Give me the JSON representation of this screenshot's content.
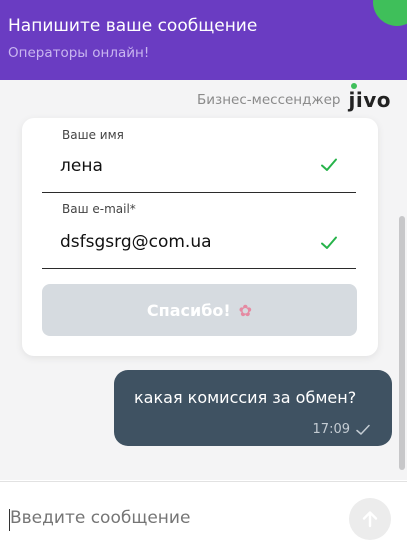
{
  "header": {
    "title": "Напишите ваше сообщение",
    "subtitle": "Операторы онлайн!"
  },
  "brand": {
    "text": "Бизнес-мессенджер",
    "logo": "jivo"
  },
  "form": {
    "name_label": "Ваше имя",
    "name_value": "лена",
    "email_label": "Ваш e-mail*",
    "email_value": "dsfsgsrg@com.ua",
    "submit_label": "Спасибо!",
    "submit_icon": "party-popper-icon"
  },
  "message": {
    "text": "какая комиссия за обмен?",
    "time": "17:09"
  },
  "composer": {
    "placeholder": "Введите сообщение"
  },
  "colors": {
    "header_bg": "#6a3cc2",
    "bubble_bg": "#3f5262",
    "check_green": "#27b34a"
  }
}
